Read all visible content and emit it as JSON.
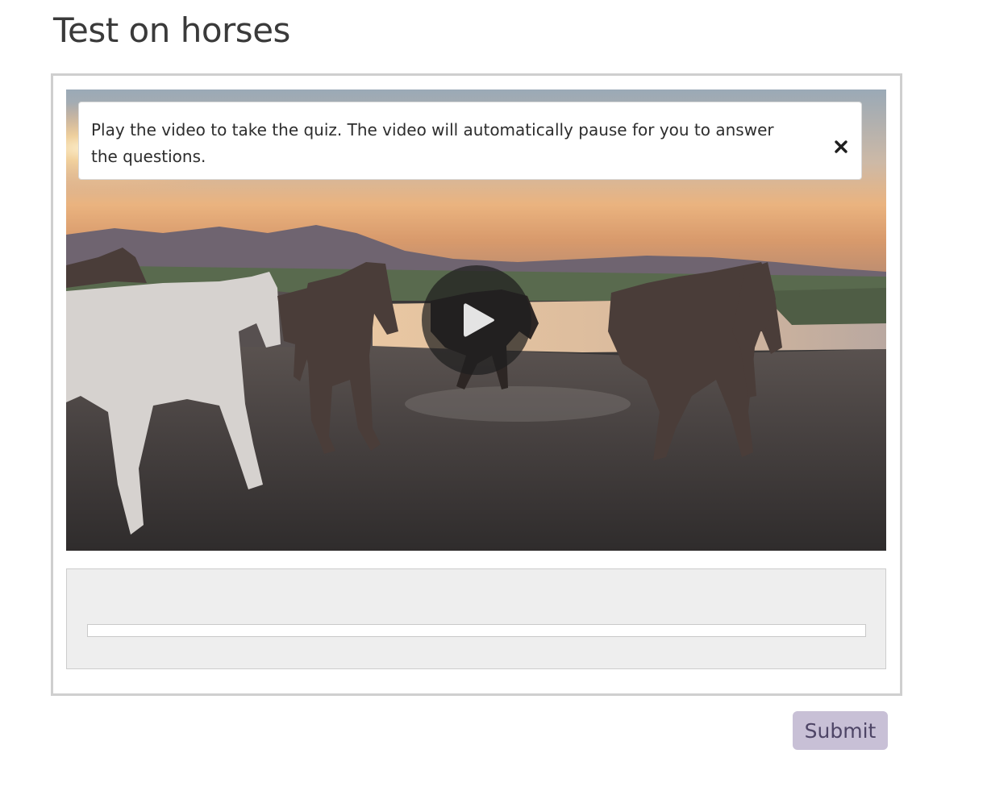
{
  "page": {
    "title": "Test on horses"
  },
  "video": {
    "notice_text": "Play the video to take the quiz. The video will automatically pause for you to answer the questions.",
    "close_icon": "close-icon",
    "play_icon": "play-icon",
    "scene_description_icon": "video-thumbnail"
  },
  "quiz": {
    "progress": 0
  },
  "actions": {
    "submit_label": "Submit"
  },
  "colors": {
    "accent": "#c8c0d6",
    "accent_text": "#4e4566",
    "frame_border": "#cfcfcf",
    "panel_bg": "#eeeeee"
  }
}
